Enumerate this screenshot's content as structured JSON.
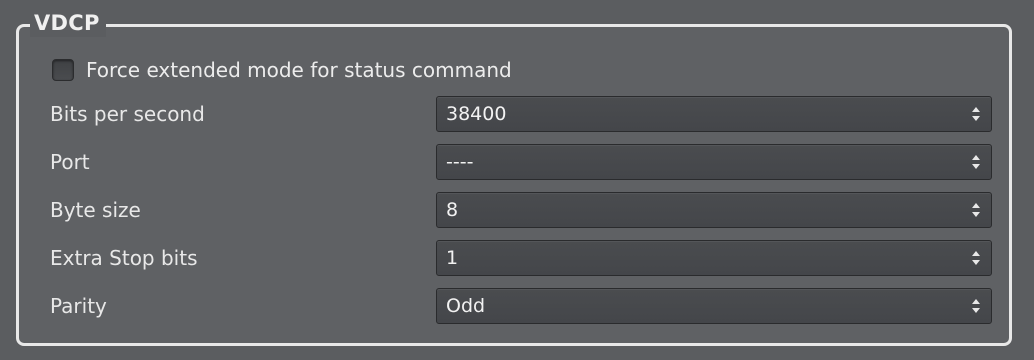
{
  "group": {
    "title": "VDCP"
  },
  "force_extended": {
    "label": "Force extended mode for status command",
    "checked": false
  },
  "fields": [
    {
      "label": "Bits per second",
      "value": "38400"
    },
    {
      "label": "Port",
      "value": "----"
    },
    {
      "label": "Byte size",
      "value": "8"
    },
    {
      "label": "Extra Stop bits",
      "value": "1"
    },
    {
      "label": "Parity",
      "value": "Odd"
    }
  ],
  "icons": {
    "spinner": "up-down-arrows-icon"
  }
}
